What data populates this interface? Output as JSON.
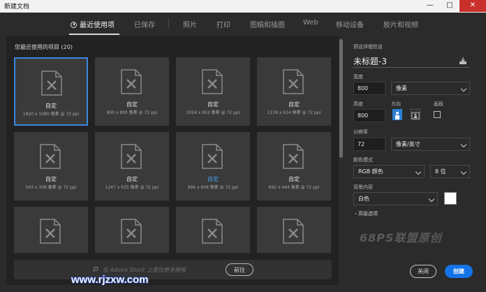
{
  "window": {
    "title": "新建文档",
    "min_label": "—",
    "max_label": "□",
    "close_label": "✕"
  },
  "tabs": [
    {
      "label": "最近使用项",
      "icon": "clock-icon",
      "active": true
    },
    {
      "label": "已保存"
    },
    {
      "label": "照片"
    },
    {
      "label": "打印"
    },
    {
      "label": "图稿和插图"
    },
    {
      "label": "Web"
    },
    {
      "label": "移动设备"
    },
    {
      "label": "胶片和视频"
    }
  ],
  "recent": {
    "title": "您最近使用的项目",
    "count": "(20)",
    "items": [
      {
        "name": "自定",
        "size": "1920 x 1080 像素 @ 72 ppi",
        "selected": true
      },
      {
        "name": "自定",
        "size": "800 x 800 像素 @ 72 ppi"
      },
      {
        "name": "自定",
        "size": "1024 x 652 像素 @ 72 ppi"
      },
      {
        "name": "自定",
        "size": "1139 x 614 像素 @ 72 ppi"
      },
      {
        "name": "自定",
        "size": "543 x 308 像素 @ 72 ppi"
      },
      {
        "name": "自定",
        "size": "1247 x 635 像素 @ 72 ppi"
      },
      {
        "name": "自定",
        "size": "996 x 608 像素 @ 72 ppi",
        "highlight": true
      },
      {
        "name": "自定",
        "size": "692 x 444 像素 @ 72 ppi"
      },
      {
        "name": "",
        "size": ""
      },
      {
        "name": "",
        "size": ""
      },
      {
        "name": "",
        "size": ""
      },
      {
        "name": "",
        "size": ""
      }
    ]
  },
  "stock": {
    "placeholder": "在 Adobe Stock 上查找更多模板",
    "go_label": "前往"
  },
  "preset": {
    "section_label": "预设详细信息",
    "doc_name": "未标题-3",
    "width_label": "宽度",
    "width_value": "800",
    "width_unit": "像素",
    "height_label": "高度",
    "height_value": "800",
    "orientation_label": "方向",
    "artboard_label": "画板",
    "resolution_label": "分辨率",
    "resolution_value": "72",
    "resolution_unit": "像素/英寸",
    "color_mode_label": "颜色模式",
    "color_mode": "RGB 颜色",
    "bit_depth": "8 位",
    "background_label": "背景内容",
    "background_value": "白色",
    "background_color": "#ffffff",
    "advanced_label": "高级选项"
  },
  "actions": {
    "close_label": "关闭",
    "create_label": "创建"
  },
  "watermark": {
    "text": "68PS联盟原创",
    "site": "www.rjzxw.com"
  },
  "colors": {
    "accent": "#1473e6",
    "selected_border": "#3b86e0"
  }
}
